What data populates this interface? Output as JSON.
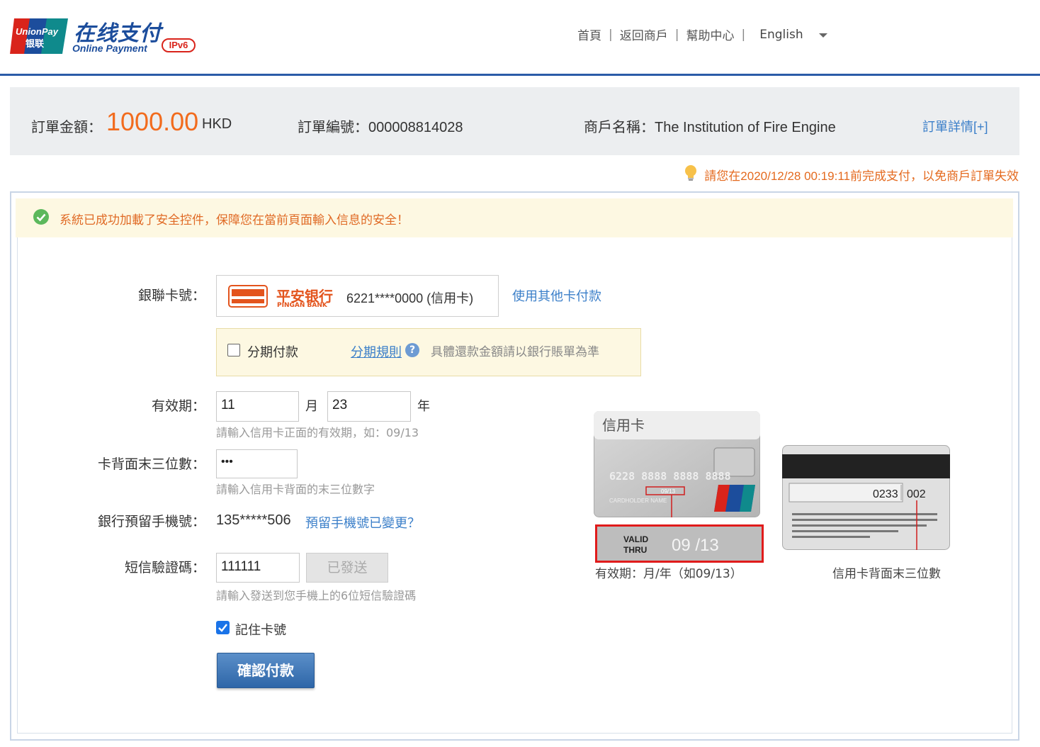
{
  "header": {
    "logo_cn": "在线支付",
    "logo_en": "Online Payment",
    "ipv6_badge": "IPv6",
    "nav": [
      "首頁",
      "返回商戶",
      "幫助中心"
    ],
    "nav_separator": "|",
    "language": "English"
  },
  "order": {
    "amount_label": "訂單金額：",
    "amount": "1000.00",
    "currency": "HKD",
    "order_no": "訂單編號：000008814028",
    "merchant": "商戶名稱：The Institution of Fire Engine",
    "detail_link": "訂單詳情[+]"
  },
  "deadline": "請您在2020/12/28 00:19:11前完成支付，以免商戶訂單失效",
  "notice": "系統已成功加載了安全控件，保障您在當前頁面輸入信息的安全！",
  "form": {
    "card_label": "銀聯卡號：",
    "bank_name": "平安银行",
    "bank_en": "PINGAN BANK",
    "card_number": "6221****0000 (信用卡)",
    "other_card_link": "使用其他卡付款",
    "installment_label": "分期付款",
    "installment_rule": "分期規則",
    "help_icon_glyph": "?",
    "installment_note": "具體還款金額請以銀行賬單為準",
    "expiry_label": "有效期：",
    "expiry_month": "11",
    "month_unit": "月",
    "expiry_year": "23",
    "year_unit": "年",
    "expiry_hint": "請輸入信用卡正面的有效期，如：09/13",
    "cvv_label": "卡背面末三位數：",
    "cvv_value": "•••",
    "cvv_hint": "請輸入信用卡背面的末三位數字",
    "phone_label": "銀行預留手機號：",
    "phone_value": "135*****506",
    "phone_changed_link": "預留手機號已變更？",
    "sms_label": "短信驗證碼：",
    "sms_value": "111111",
    "sms_button": "已發送",
    "sms_hint": "請輸入發送到您手機上的6位短信驗證碼",
    "remember_label": "記住卡號",
    "submit_button": "確認付款"
  },
  "illustration": {
    "front_title": "信用卡",
    "front_number": "6228 8888 8888 8888",
    "cardholder": "CARDHOLDER NAME",
    "small_expiry": "09/13",
    "valid_thru_1": "VALID",
    "valid_thru_2": "THRU",
    "valid_date": "09 /13",
    "back_code_1": "0233",
    "back_code_2": "002",
    "front_caption": "有效期：月/年（如09/13）",
    "back_caption": "信用卡背面末三位數"
  },
  "colors": {
    "brand_blue": "#2a5ba8",
    "amount_orange": "#f26b1d",
    "link_blue": "#3b7fc9",
    "notice_orange": "#e06a25",
    "notice_bg": "#fdf8e2"
  }
}
